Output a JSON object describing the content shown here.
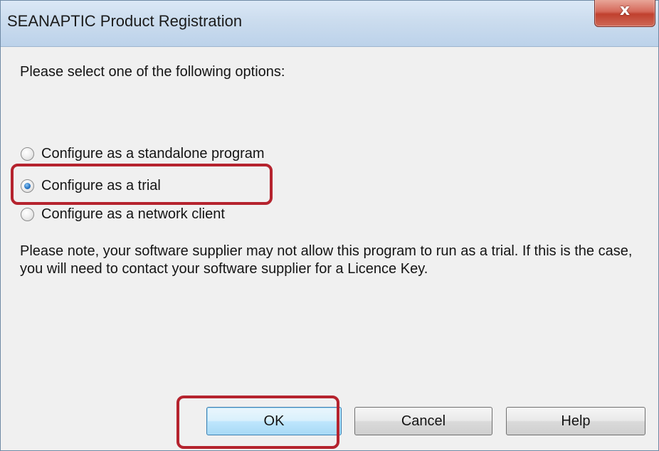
{
  "window": {
    "title": "SEANAPTIC Product Registration",
    "close_symbol": "x",
    "close_icon": "close-icon"
  },
  "dialog": {
    "instruction": "Please select one of the following options:",
    "options": [
      {
        "label": "Configure as a standalone program",
        "checked": false
      },
      {
        "label": "Configure as a trial",
        "checked": true
      },
      {
        "label": "Configure as a network client",
        "checked": false
      }
    ],
    "note": "Please note, your software supplier may not allow this program to run as a trial. If this is the case, you will need to contact your software supplier for a Licence Key."
  },
  "buttons": {
    "ok": "OK",
    "cancel": "Cancel",
    "help": "Help"
  },
  "colors": {
    "highlight": "#b5232e",
    "radio_selected": "#2a78c6",
    "title_bar": "#cbdcee",
    "close_button": "#c0402e"
  }
}
